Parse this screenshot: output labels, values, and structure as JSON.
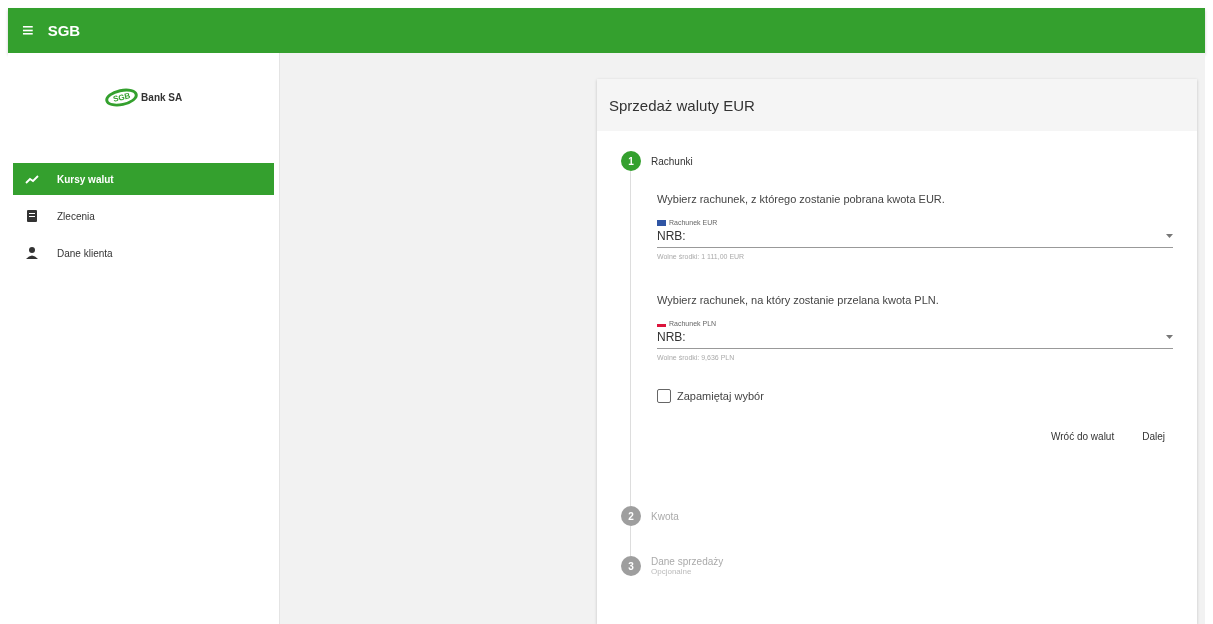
{
  "topbar": {
    "menu_icon": "≡",
    "title": "SGB"
  },
  "sidebar": {
    "logo_badge": "SGB",
    "logo_text": "Bank SA",
    "items": [
      {
        "label": "Kursy walut",
        "kind": "chart",
        "selected": true
      },
      {
        "label": "Zlecenia",
        "kind": "clipboard",
        "selected": false
      },
      {
        "label": "Dane klienta",
        "kind": "person",
        "selected": false
      }
    ]
  },
  "card": {
    "title": "Sprzedaż waluty EUR",
    "steps": [
      {
        "number": "1",
        "label": "Rachunki",
        "active": true
      },
      {
        "number": "2",
        "label": "Kwota",
        "active": false
      },
      {
        "number": "3",
        "label": "Dane sprzedaży",
        "sublabel": "Opcjonalne",
        "active": false
      }
    ],
    "fields": [
      {
        "prompt": "Wybierz rachunek, z którego zostanie pobrana kwota EUR.",
        "label": "Rachunek EUR",
        "value": "NRB:",
        "hint": "Wolne środki: 1 111,00 EUR"
      },
      {
        "prompt": "Wybierz rachunek, na który zostanie przelana kwota PLN.",
        "label": "Rachunek PLN",
        "value": "NRB:",
        "hint": "Wolne środki: 9,636 PLN"
      }
    ],
    "remember": {
      "label": "Zapamiętaj wybór",
      "checked": false
    },
    "buttons": [
      "Wróć do walut",
      "Dalej"
    ]
  }
}
